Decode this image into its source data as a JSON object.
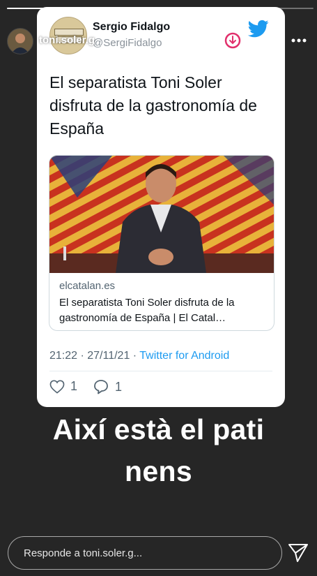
{
  "story": {
    "progress_fraction": 0.76,
    "username": "toni.soler.g",
    "caption_line1": "Així està el pati",
    "caption_line2": "nens"
  },
  "tweet": {
    "author_name": "Sergio Fidalgo",
    "author_handle": "@SergiFidalgo",
    "text": "El separatista Toni Soler disfruta de la gastronomía de España",
    "link_domain": "elcatalan.es",
    "link_title": "El separatista Toni Soler disfruta de la gastronomía de España | El Catal…",
    "time": "21:22 · 27/11/21 · ",
    "source": "Twitter for Android",
    "likes": "1",
    "replies": "1"
  },
  "reply_bar": {
    "placeholder": "Responde a toni.soler.g..."
  },
  "colors": {
    "background": "#262626",
    "twitter_blue": "#1d9bf0",
    "story_ring": "#e1306c"
  },
  "icons": [
    "twitter-bird-icon",
    "pause-icon",
    "download-icon",
    "mute-icon",
    "more-icon",
    "heart-icon",
    "comment-icon",
    "send-icon"
  ]
}
